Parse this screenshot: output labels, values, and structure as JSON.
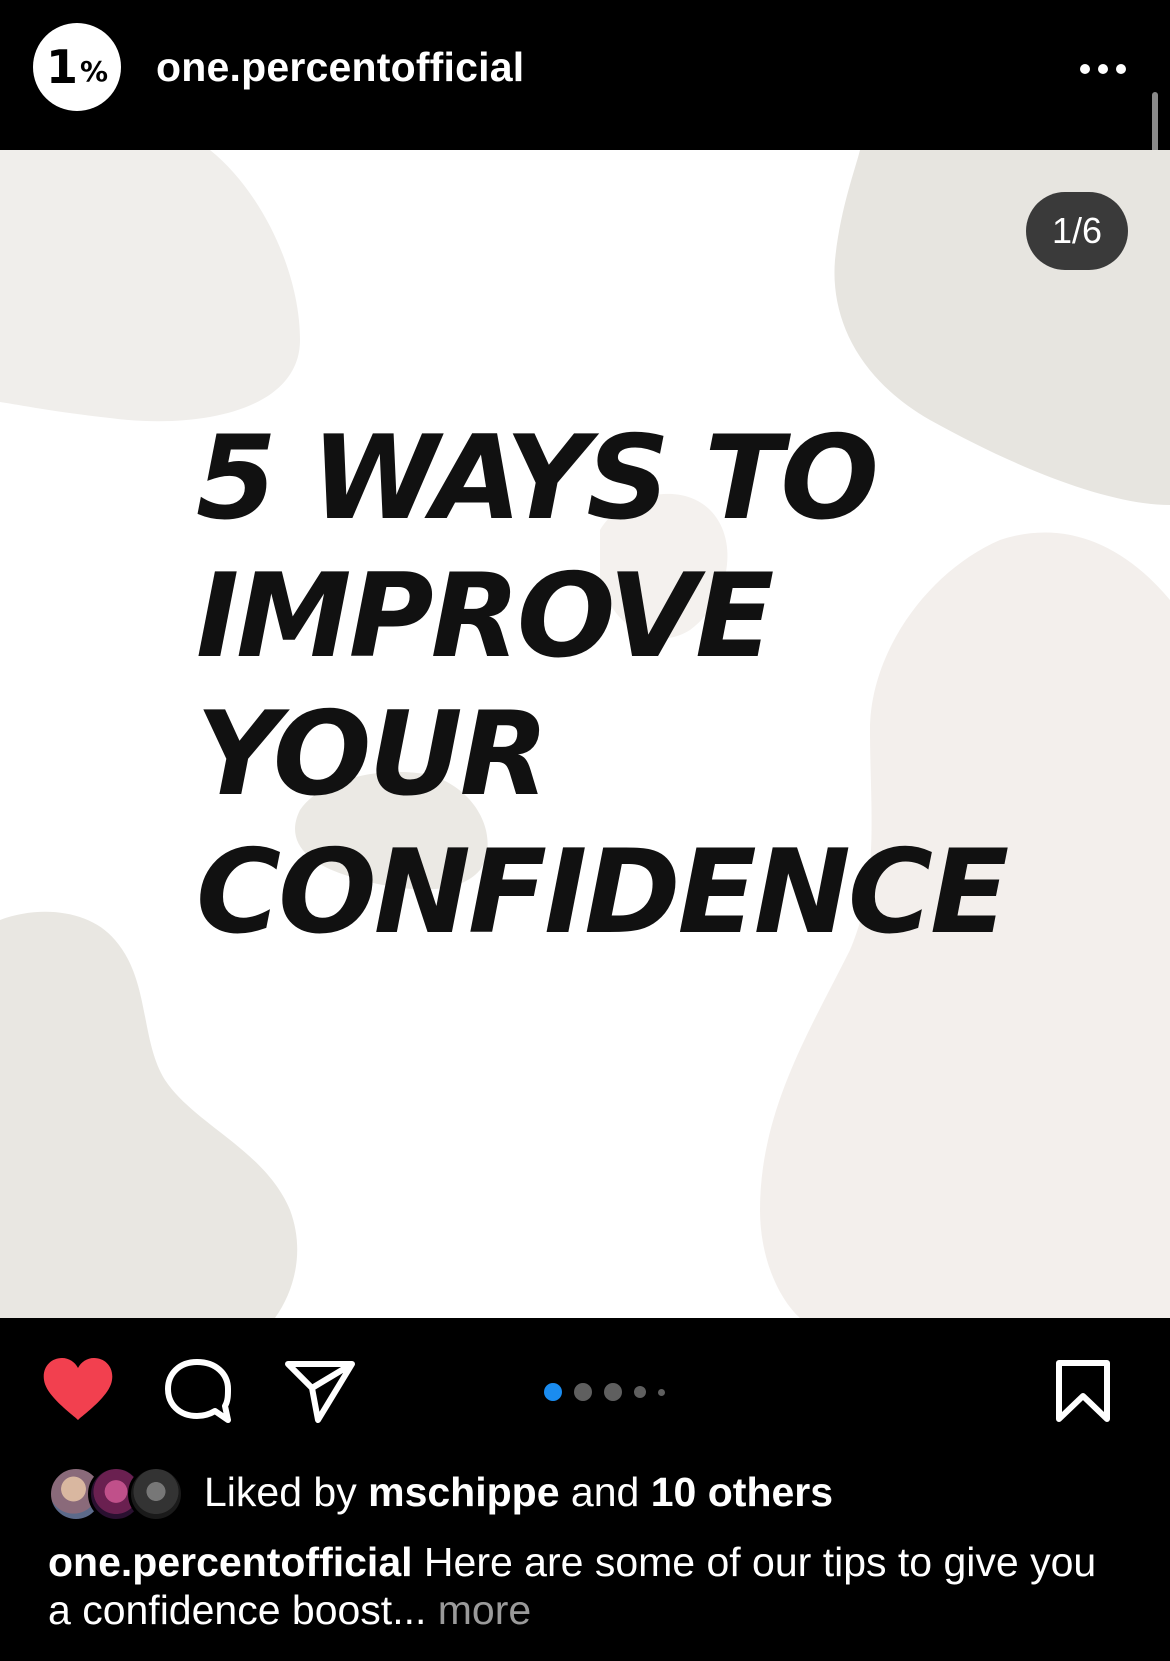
{
  "header": {
    "avatar_one": "1",
    "avatar_pct": "%",
    "username": "one.percentofficial"
  },
  "post": {
    "counter": "1/6",
    "headline": "5 WAYS TO\nIMPROVE\nYOUR\nCONFIDENCE",
    "slide_index": 1,
    "slide_total": 6
  },
  "likes": {
    "prefix": "Liked by",
    "user": "mschippe",
    "middle": "and",
    "others": "10 others"
  },
  "caption": {
    "username": "one.percentofficial",
    "text": "Here are some of our tips to give you a confidence boost...",
    "more": "more"
  },
  "colors": {
    "like_red": "#f2404f",
    "active_dot": "#1a8cf0"
  }
}
